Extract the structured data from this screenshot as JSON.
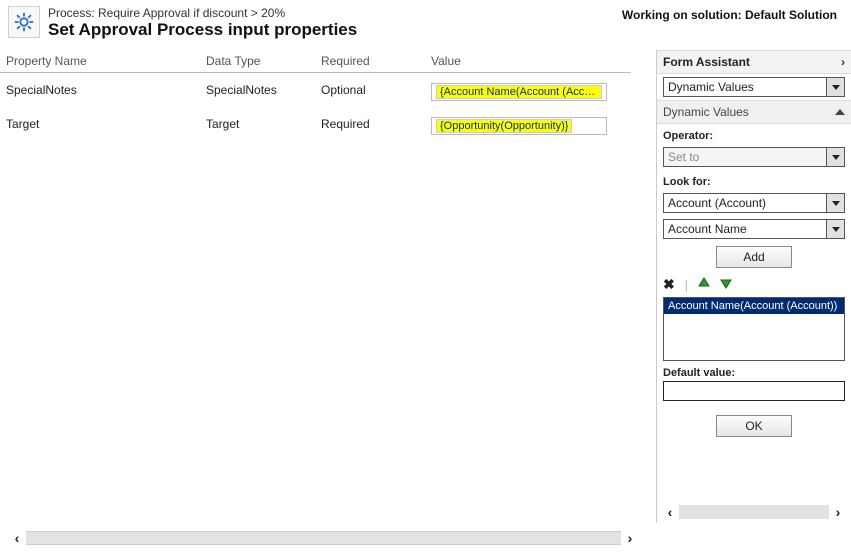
{
  "header": {
    "process_label": "Process: Require Approval if discount > 20%",
    "title": "Set Approval Process input properties",
    "working_on": "Working on solution: Default Solution"
  },
  "columns": {
    "name": "Property Name",
    "type": "Data Type",
    "required": "Required",
    "value": "Value"
  },
  "rows": [
    {
      "name": "SpecialNotes",
      "type": "SpecialNotes",
      "required": "Optional",
      "value": "{Account Name(Account (Account))}"
    },
    {
      "name": "Target",
      "type": "Target",
      "required": "Required",
      "value": "{Opportunity(Opportunity)}"
    }
  ],
  "form_assistant": {
    "title": "Form Assistant",
    "top_dropdown": "Dynamic Values",
    "section_title": "Dynamic Values",
    "operator_label": "Operator:",
    "operator_value": "Set to",
    "lookfor_label": "Look for:",
    "lookfor_entity": "Account (Account)",
    "lookfor_attribute": "Account Name",
    "add_label": "Add",
    "list_selected": "Account Name(Account (Account))",
    "default_label": "Default value:",
    "default_value": "",
    "ok_label": "OK"
  }
}
